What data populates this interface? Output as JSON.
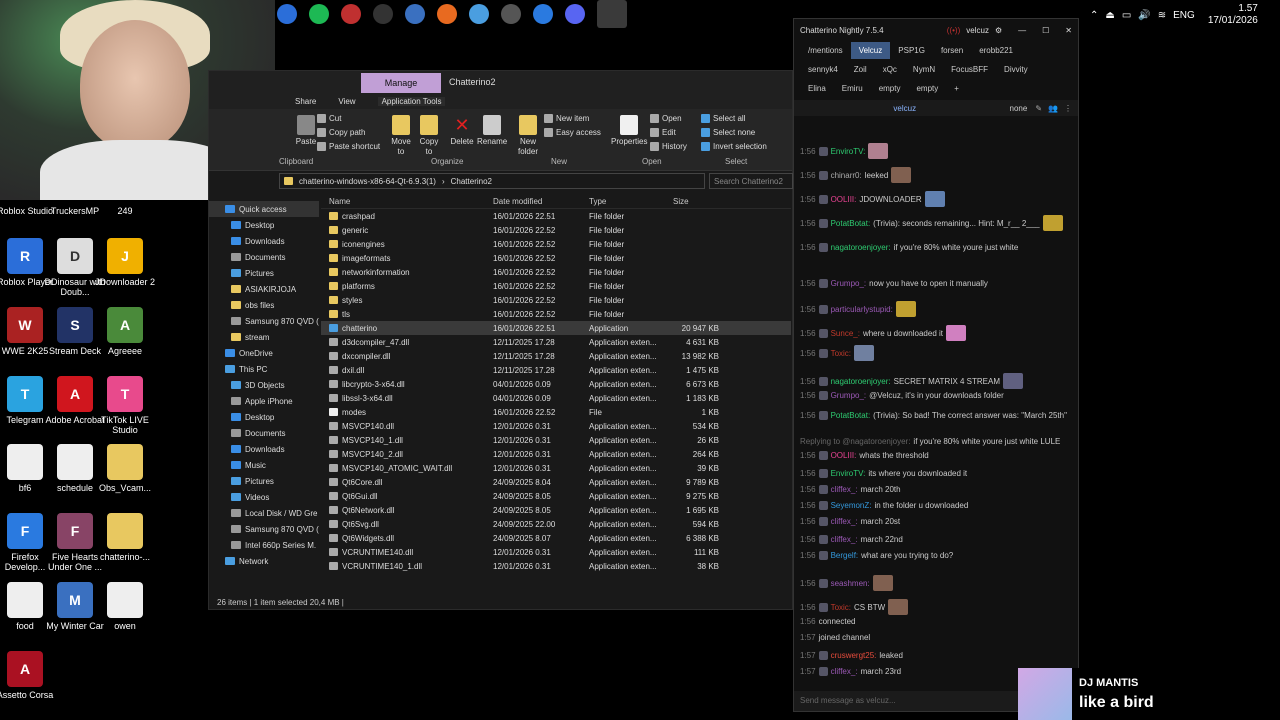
{
  "taskbar": {
    "icons": [
      "media-icon",
      "spotify-icon",
      "sound-icon",
      "obs-icon",
      "chatterino-icon",
      "firefox-icon",
      "app-icon",
      "obs-icon-2",
      "firefox-dev-icon",
      "discord-icon",
      "chatterino-active-icon"
    ],
    "tray": {
      "lang": "ENG",
      "time": "1.57",
      "date": "17/01/2026"
    }
  },
  "desktop": {
    "icons": [
      {
        "label": "Roblox Studio",
        "color": "#2b6ed9",
        "glyph": "R"
      },
      {
        "label": "TruckersMP",
        "color": "#333333",
        "glyph": "T"
      },
      {
        "label": "249",
        "color": "#333333",
        "glyph": ""
      },
      {
        "label": "Roblox Player",
        "color": "#2b6ed9",
        "glyph": "R"
      },
      {
        "label": "DDinosaur with Doub...",
        "color": "#dddddd",
        "glyph": "D"
      },
      {
        "label": "JDownloader 2",
        "color": "#f0b000",
        "glyph": "J"
      },
      {
        "label": "WWE 2K25",
        "color": "#aa2222",
        "glyph": "W"
      },
      {
        "label": "Stream Deck",
        "color": "#223366",
        "glyph": "S"
      },
      {
        "label": "Agreeee",
        "color": "#4a8a3a",
        "glyph": "A"
      },
      {
        "label": "Telegram",
        "color": "#2aa3e0",
        "glyph": "T"
      },
      {
        "label": "Adobe Acrobat",
        "color": "#d0161e",
        "glyph": "A"
      },
      {
        "label": "TikTok LIVE Studio",
        "color": "#e84a8c",
        "glyph": "T"
      },
      {
        "label": "bf6",
        "color": "#eeeeee",
        "glyph": ""
      },
      {
        "label": "schedule",
        "color": "#eeeeee",
        "glyph": ""
      },
      {
        "label": "Obs_Vcam...",
        "color": "#e8c860",
        "glyph": ""
      },
      {
        "label": "Firefox Develop...",
        "color": "#2a7ae0",
        "glyph": "F"
      },
      {
        "label": "Five Hearts Under One ...",
        "color": "#884466",
        "glyph": "F"
      },
      {
        "label": "chatterino-...",
        "color": "#e8c860",
        "glyph": ""
      },
      {
        "label": "food",
        "color": "#eeeeee",
        "glyph": ""
      },
      {
        "label": "My Winter Car",
        "color": "#3a70c0",
        "glyph": "M"
      },
      {
        "label": "owen",
        "color": "#eeeeee",
        "glyph": ""
      },
      {
        "label": "Assetto Corsa",
        "color": "#aa1122",
        "glyph": "A"
      }
    ]
  },
  "explorer": {
    "manage_tab": "Manage",
    "title": "Chatterino2",
    "ribbon_tabs": [
      "Share",
      "View",
      "Application Tools"
    ],
    "ribbon": {
      "cut": "Cut",
      "copy_path": "Copy path",
      "paste_shortcut": "Paste shortcut",
      "paste": "Paste",
      "move_to": "Move to",
      "copy_to": "Copy to",
      "delete": "Delete",
      "rename": "Rename",
      "new_folder": "New folder",
      "new_item": "New item",
      "easy_access": "Easy access",
      "properties": "Properties",
      "open": "Open",
      "edit": "Edit",
      "history": "History",
      "select_all": "Select all",
      "select_none": "Select none",
      "invert_selection": "Invert selection",
      "groups": [
        "Clipboard",
        "Organize",
        "New",
        "Open",
        "Select"
      ]
    },
    "address": [
      "chatterino-windows-x86-64-Qt-6.9.3(1)",
      "Chatterino2"
    ],
    "search_placeholder": "Search Chatterino2",
    "nav": [
      {
        "label": "Quick access",
        "color": "#3a8ee6",
        "sel": true,
        "indent": false
      },
      {
        "label": "Desktop",
        "color": "#3a8ee6",
        "indent": true
      },
      {
        "label": "Downloads",
        "color": "#3a8ee6",
        "indent": true
      },
      {
        "label": "Documents",
        "color": "#999999",
        "indent": true
      },
      {
        "label": "Pictures",
        "color": "#4a9ee0",
        "indent": true
      },
      {
        "label": "ASIAKIRJOJA",
        "color": "#e8c860",
        "indent": true
      },
      {
        "label": "obs files",
        "color": "#e8c860",
        "indent": true
      },
      {
        "label": "Samsung 870 QVD (",
        "color": "#999999",
        "indent": true
      },
      {
        "label": "stream",
        "color": "#e8c860",
        "indent": true
      },
      {
        "label": "OneDrive",
        "color": "#3a8ee6",
        "indent": false
      },
      {
        "label": "This PC",
        "color": "#4a9ee0",
        "indent": false
      },
      {
        "label": "3D Objects",
        "color": "#4a9ee0",
        "indent": true
      },
      {
        "label": "Apple iPhone",
        "color": "#999999",
        "indent": true
      },
      {
        "label": "Desktop",
        "color": "#3a8ee6",
        "indent": true
      },
      {
        "label": "Documents",
        "color": "#999999",
        "indent": true
      },
      {
        "label": "Downloads",
        "color": "#3a8ee6",
        "indent": true
      },
      {
        "label": "Music",
        "color": "#3a8ee6",
        "indent": true
      },
      {
        "label": "Pictures",
        "color": "#4a9ee0",
        "indent": true
      },
      {
        "label": "Videos",
        "color": "#4a9ee0",
        "indent": true
      },
      {
        "label": "Local Disk / WD Gre",
        "color": "#999999",
        "indent": true
      },
      {
        "label": "Samsung 870 QVD (",
        "color": "#999999",
        "indent": true
      },
      {
        "label": "Intel 660p Series M.",
        "color": "#999999",
        "indent": true
      },
      {
        "label": "Network",
        "color": "#4a9ee0",
        "indent": false
      }
    ],
    "columns": [
      "Name",
      "Date modified",
      "Type",
      "Size"
    ],
    "files": [
      {
        "name": "crashpad",
        "date": "16/01/2026 22.51",
        "type": "File folder",
        "size": "",
        "kind": "folder"
      },
      {
        "name": "generic",
        "date": "16/01/2026 22.52",
        "type": "File folder",
        "size": "",
        "kind": "folder"
      },
      {
        "name": "iconengines",
        "date": "16/01/2026 22.52",
        "type": "File folder",
        "size": "",
        "kind": "folder"
      },
      {
        "name": "imageformats",
        "date": "16/01/2026 22.52",
        "type": "File folder",
        "size": "",
        "kind": "folder"
      },
      {
        "name": "networkinformation",
        "date": "16/01/2026 22.52",
        "type": "File folder",
        "size": "",
        "kind": "folder"
      },
      {
        "name": "platforms",
        "date": "16/01/2026 22.52",
        "type": "File folder",
        "size": "",
        "kind": "folder"
      },
      {
        "name": "styles",
        "date": "16/01/2026 22.52",
        "type": "File folder",
        "size": "",
        "kind": "folder"
      },
      {
        "name": "tls",
        "date": "16/01/2026 22.52",
        "type": "File folder",
        "size": "",
        "kind": "folder"
      },
      {
        "name": "chatterino",
        "date": "16/01/2026 22.51",
        "type": "Application",
        "size": "20 947 KB",
        "kind": "app",
        "sel": true
      },
      {
        "name": "d3dcompiler_47.dll",
        "date": "12/11/2025 17.28",
        "type": "Application exten...",
        "size": "4 631 KB",
        "kind": "dll"
      },
      {
        "name": "dxcompiler.dll",
        "date": "12/11/2025 17.28",
        "type": "Application exten...",
        "size": "13 982 KB",
        "kind": "dll"
      },
      {
        "name": "dxil.dll",
        "date": "12/11/2025 17.28",
        "type": "Application exten...",
        "size": "1 475 KB",
        "kind": "dll"
      },
      {
        "name": "libcrypto-3-x64.dll",
        "date": "04/01/2026 0.09",
        "type": "Application exten...",
        "size": "6 673 KB",
        "kind": "dll"
      },
      {
        "name": "libssl-3-x64.dll",
        "date": "04/01/2026 0.09",
        "type": "Application exten...",
        "size": "1 183 KB",
        "kind": "dll"
      },
      {
        "name": "modes",
        "date": "16/01/2026 22.52",
        "type": "File",
        "size": "1 KB",
        "kind": "file"
      },
      {
        "name": "MSVCP140.dll",
        "date": "12/01/2026 0.31",
        "type": "Application exten...",
        "size": "534 KB",
        "kind": "dll"
      },
      {
        "name": "MSVCP140_1.dll",
        "date": "12/01/2026 0.31",
        "type": "Application exten...",
        "size": "26 KB",
        "kind": "dll"
      },
      {
        "name": "MSVCP140_2.dll",
        "date": "12/01/2026 0.31",
        "type": "Application exten...",
        "size": "264 KB",
        "kind": "dll"
      },
      {
        "name": "MSVCP140_ATOMIC_WAIT.dll",
        "date": "12/01/2026 0.31",
        "type": "Application exten...",
        "size": "39 KB",
        "kind": "dll"
      },
      {
        "name": "Qt6Core.dll",
        "date": "24/09/2025 8.04",
        "type": "Application exten...",
        "size": "9 789 KB",
        "kind": "dll"
      },
      {
        "name": "Qt6Gui.dll",
        "date": "24/09/2025 8.05",
        "type": "Application exten...",
        "size": "9 275 KB",
        "kind": "dll"
      },
      {
        "name": "Qt6Network.dll",
        "date": "24/09/2025 8.05",
        "type": "Application exten...",
        "size": "1 695 KB",
        "kind": "dll"
      },
      {
        "name": "Qt6Svg.dll",
        "date": "24/09/2025 22.00",
        "type": "Application exten...",
        "size": "594 KB",
        "kind": "dll"
      },
      {
        "name": "Qt6Widgets.dll",
        "date": "24/09/2025 8.07",
        "type": "Application exten...",
        "size": "6 388 KB",
        "kind": "dll"
      },
      {
        "name": "VCRUNTIME140.dll",
        "date": "12/01/2026 0.31",
        "type": "Application exten...",
        "size": "111 KB",
        "kind": "dll"
      },
      {
        "name": "VCRUNTIME140_1.dll",
        "date": "12/01/2026 0.31",
        "type": "Application exten...",
        "size": "38 KB",
        "kind": "dll"
      }
    ],
    "status": "26 items  |  1 item selected  20,4 MB  |"
  },
  "chat": {
    "title": "Chatterino Nightly 7.5.4",
    "user": "velcuz",
    "tabs_row1": [
      "/mentions",
      "Velcuz",
      "PSP1G",
      "forsen",
      "erobb221"
    ],
    "tabs_row2": [
      "sennyk4",
      "Zoil",
      "xQc",
      "NymN",
      "FocusBFF",
      "Divvity"
    ],
    "tabs_row3": [
      "Elina",
      "Emiru",
      "empty",
      "empty"
    ],
    "channel": "velcuz",
    "channel_mode": "none",
    "messages": [
      {
        "time": "1:56",
        "user": "EnviroTV:",
        "color": "#2ecc71",
        "text": "",
        "emote": "#b08090"
      },
      {
        "time": "1:56",
        "user": "chinarr0:",
        "color": "#aaaaaa",
        "text": "leeked",
        "emote": "#806050"
      },
      {
        "time": "1:56",
        "user": "OOLIII:",
        "color": "#e84393",
        "text": "JDOWNLOADER",
        "emote": "#6080b0"
      },
      {
        "time": "1:56",
        "user": "PotatBotat:",
        "color": "#2ecc71",
        "text": "(Trivia): seconds remaining... Hint: M_r__ 2___",
        "emote": "#c0a030"
      },
      {
        "time": "1:56",
        "user": "nagatoroenjoyer:",
        "color": "#2ecc71",
        "text": "if you're 80% white youre just white",
        "emote": ""
      },
      {
        "time": "1:56",
        "user": "Grumpo_:",
        "color": "#9b59b6",
        "text": "now you have to open it manually",
        "emote": ""
      },
      {
        "time": "1:56",
        "user": "particularlystupid:",
        "color": "#9b59b6",
        "text": "",
        "emote": "#c0a030"
      },
      {
        "time": "1:56",
        "user": "Sunce_:",
        "color": "#c0392b",
        "text": "where u downloaded it",
        "emote": "#d080c0"
      },
      {
        "time": "1:56",
        "user": "Toxic:",
        "color": "#c0392b",
        "text": "",
        "emote": "#7080a0"
      },
      {
        "time": "1:56",
        "user": "nagatoroenjoyer:",
        "color": "#2ecc71",
        "text": "SECRET MATRIX 4 STREAM",
        "emote": "#606080"
      },
      {
        "time": "1:56",
        "user": "Grumpo_:",
        "color": "#9b59b6",
        "text": "@Velcuz, it's in your downloads folder",
        "emote": ""
      },
      {
        "time": "1:56",
        "user": "PotatBotat:",
        "color": "#2ecc71",
        "text": "(Trivia): So bad! The correct answer was: \"March 25th\"",
        "emote": ""
      },
      {
        "time": "",
        "user": "Replying to @nagatoroenjoyer:",
        "color": "#666666",
        "text": "if you're 80% white youre just white LULE",
        "emote": ""
      },
      {
        "time": "1:56",
        "user": "OOLIII:",
        "color": "#e84393",
        "text": "whats the threshold",
        "emote": ""
      },
      {
        "time": "1:56",
        "user": "EnviroTV:",
        "color": "#2ecc71",
        "text": "its where you downloaded it",
        "emote": ""
      },
      {
        "time": "1:56",
        "user": "cliffex_:",
        "color": "#9b59b6",
        "text": "march 20th",
        "emote": ""
      },
      {
        "time": "1:56",
        "user": "SeyemonZ:",
        "color": "#3498db",
        "text": "in the folder u downloaded",
        "emote": ""
      },
      {
        "time": "1:56",
        "user": "cliffex_:",
        "color": "#9b59b6",
        "text": "march 20st",
        "emote": ""
      },
      {
        "time": "1:56",
        "user": "cliffex_:",
        "color": "#9b59b6",
        "text": "march 22nd",
        "emote": ""
      },
      {
        "time": "1:56",
        "user": "Bergelf:",
        "color": "#3498db",
        "text": "what are you trying to do?",
        "emote": ""
      },
      {
        "time": "1:56",
        "user": "seashmen:",
        "color": "#9b59b6",
        "text": "",
        "emote": "#806050"
      },
      {
        "time": "1:56",
        "user": "Toxic:",
        "color": "#c0392b",
        "text": "CS BTW",
        "emote": "#806050"
      },
      {
        "time": "1:56",
        "user": "",
        "color": "#cccccc",
        "text": "connected",
        "emote": ""
      },
      {
        "time": "1:57",
        "user": "",
        "color": "#cccccc",
        "text": "joined channel",
        "emote": ""
      },
      {
        "time": "1:57",
        "user": "cruswergt25:",
        "color": "#e74c3c",
        "text": "leaked",
        "emote": ""
      },
      {
        "time": "1:57",
        "user": "cliffex_:",
        "color": "#9b59b6",
        "text": "march 23rd",
        "emote": ""
      }
    ],
    "input_placeholder": "Send message as velcuz..."
  },
  "now_playing": {
    "artist": "DJ MANTIS",
    "song": "like a bird"
  }
}
